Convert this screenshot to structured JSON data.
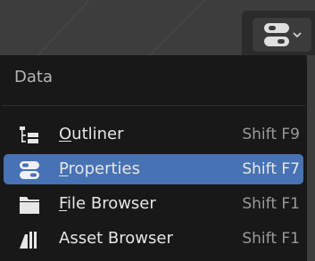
{
  "menu": {
    "header": "Data",
    "items": [
      {
        "label_mnemonic": "O",
        "label_rest": "utliner",
        "shortcut": "Shift F9",
        "icon": "outliner-icon",
        "active": false
      },
      {
        "label_mnemonic": "P",
        "label_rest": "roperties",
        "shortcut": "Shift F7",
        "icon": "properties-icon",
        "active": true
      },
      {
        "label_mnemonic": "F",
        "label_rest": "ile Browser",
        "shortcut": "Shift F1",
        "icon": "file-browser-icon",
        "active": false
      },
      {
        "label_mnemonic": "",
        "label_rest": "Asset Browser",
        "shortcut": "Shift F1",
        "icon": "asset-browser-icon",
        "active": false
      }
    ]
  },
  "editor_type_button": {
    "icon": "properties-icon",
    "dropdown_icon": "chevron-down-icon"
  },
  "colors": {
    "accent": "#4772b3",
    "menu_bg": "#181818",
    "text": "#e6e6e6",
    "shortcut_text": "#9a9a9a"
  }
}
